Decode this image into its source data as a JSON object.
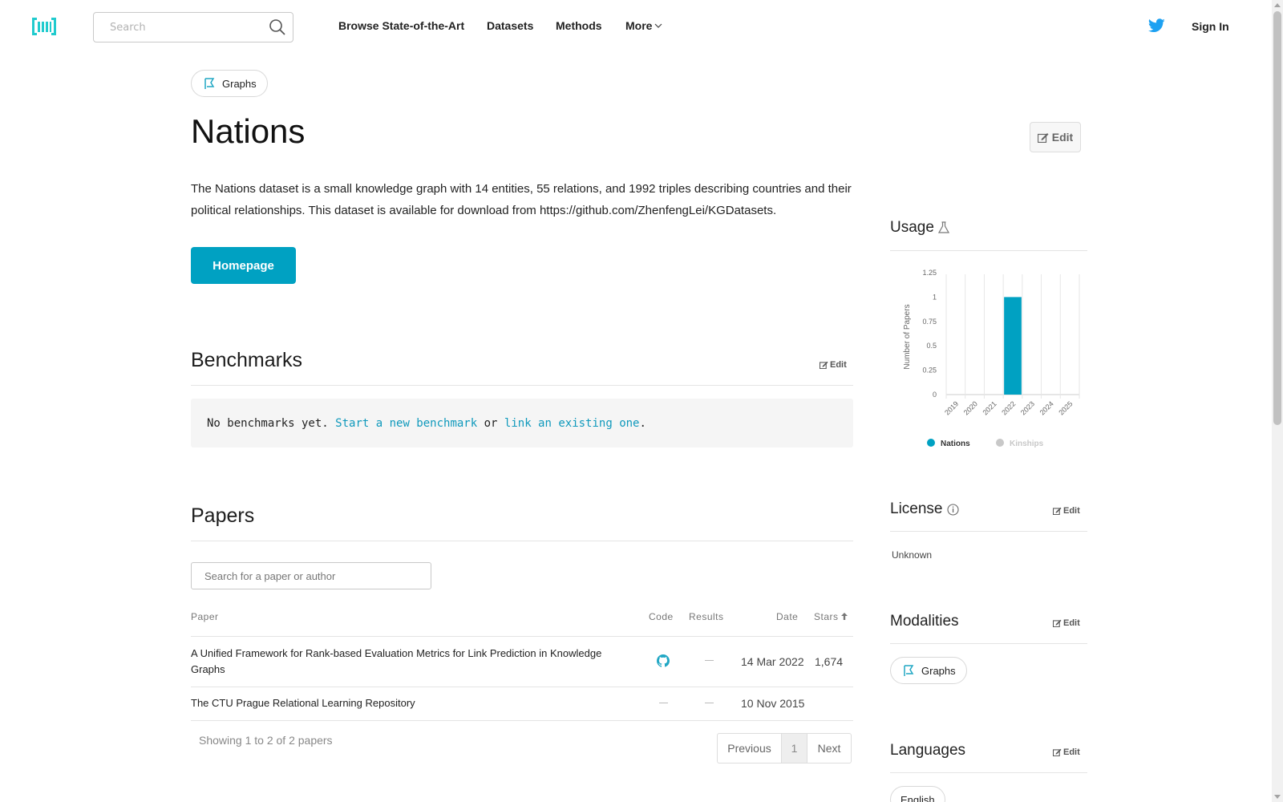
{
  "nav": {
    "search_placeholder": "Search",
    "links": [
      "Browse State-of-the-Art",
      "Datasets",
      "Methods",
      "More"
    ],
    "sign_in": "Sign In"
  },
  "dataset": {
    "modality_tag": "Graphs",
    "title": "Nations",
    "edit_label": "Edit",
    "description": "The Nations dataset is a small knowledge graph with 14 entities, 55 relations, and 1992 triples describing countries and their political relationships. This dataset is available for download from https://github.com/ZhenfengLei/KGDatasets.",
    "homepage_label": "Homepage"
  },
  "benchmarks": {
    "title": "Benchmarks",
    "edit_label": "Edit",
    "empty_prefix": "No benchmarks yet.",
    "start_link": "Start a new benchmark",
    "or_text": "or",
    "link_existing": "link an existing one",
    "period": "."
  },
  "papers": {
    "title": "Papers",
    "search_placeholder": "Search for a paper or author",
    "columns": [
      "Paper",
      "Code",
      "Results",
      "Date",
      "Stars"
    ],
    "rows": [
      {
        "title": "A Unified Framework for Rank-based Evaluation Metrics for Link Prediction in Knowledge Graphs",
        "code": "github",
        "results": "—",
        "date": "14 Mar 2022",
        "stars": "1,674"
      },
      {
        "title": "The CTU Prague Relational Learning Repository",
        "code": "—",
        "results": "—",
        "date": "10 Nov 2015",
        "stars": ""
      }
    ],
    "showing": "Showing 1 to 2 of 2 papers",
    "pagination": {
      "previous": "Previous",
      "current": "1",
      "next": "Next"
    }
  },
  "sidebar": {
    "usage_title": "Usage",
    "license_title": "License",
    "license_value": "Unknown",
    "modalities_title": "Modalities",
    "modalities": [
      "Graphs"
    ],
    "languages_title": "Languages",
    "languages": [
      "English"
    ],
    "edit_label": "Edit"
  },
  "colors": {
    "accent": "#00a1c2",
    "link": "#0f99bc",
    "inactive_legend": "#c8c8c8"
  },
  "chart_data": {
    "type": "bar",
    "ylabel": "Number of Papers",
    "xlabel": "",
    "categories": [
      "2019",
      "2020",
      "2021",
      "2022",
      "2023",
      "2024",
      "2025"
    ],
    "yticks": [
      "0",
      "0.25",
      "0.5",
      "0.75",
      "1",
      "1.25"
    ],
    "ylim": [
      0,
      1.25
    ],
    "series": [
      {
        "name": "Nations",
        "values": [
          0,
          0,
          0,
          1,
          0,
          0,
          0
        ],
        "color": "#00a1c2",
        "active": true
      },
      {
        "name": "Kinships",
        "values": [
          0,
          0,
          0,
          0,
          0,
          0,
          0
        ],
        "color": "#c8c8c8",
        "active": false
      }
    ],
    "legend_position": "bottom"
  }
}
